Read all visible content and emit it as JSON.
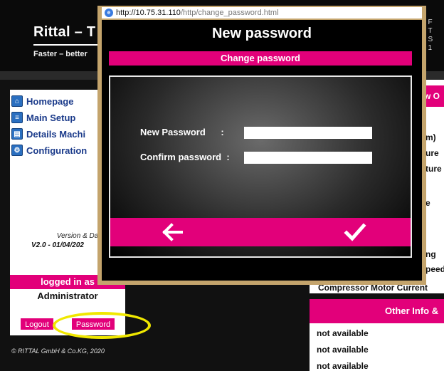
{
  "header": {
    "brand": "Rittal – T",
    "tagline": "Faster – better",
    "right_text": ": F\n: T\n: S\n: 1"
  },
  "sidebar": {
    "items": [
      {
        "label": "Homepage",
        "icon": "home-icon"
      },
      {
        "label": "Main Setup",
        "icon": "setup-icon"
      },
      {
        "label": "Details Machi",
        "icon": "details-icon"
      },
      {
        "label": "Configuration",
        "icon": "config-icon"
      }
    ],
    "version_label": "Version & Date Rele",
    "version_value": "V2.0 - 01/04/202",
    "logged_in": "logged in as",
    "user": "Administrator",
    "logout_label": "Logout",
    "password_label": "Password",
    "copyright": "© RITTAL GmbH & Co.KG, 2020"
  },
  "right_panel": {
    "header": "w O",
    "rows": [
      "m)",
      "ure",
      "ture",
      "e",
      "ng",
      "peed"
    ],
    "compressor": "Compressor Motor Current",
    "other_info": "Other Info &",
    "not_available": [
      "not available",
      "not available",
      "not available"
    ]
  },
  "popup": {
    "url_host": "http://10.75.31.110",
    "url_path": "/http/change_password.html",
    "title": "New password",
    "bar_label": "Change password",
    "new_password_label": "New Password      :",
    "confirm_password_label": "Confirm password  :",
    "new_password_value": "",
    "confirm_password_value": ""
  },
  "colors": {
    "accent": "#e2007a",
    "highlight": "#f0e800",
    "link": "#1a3a8a"
  }
}
